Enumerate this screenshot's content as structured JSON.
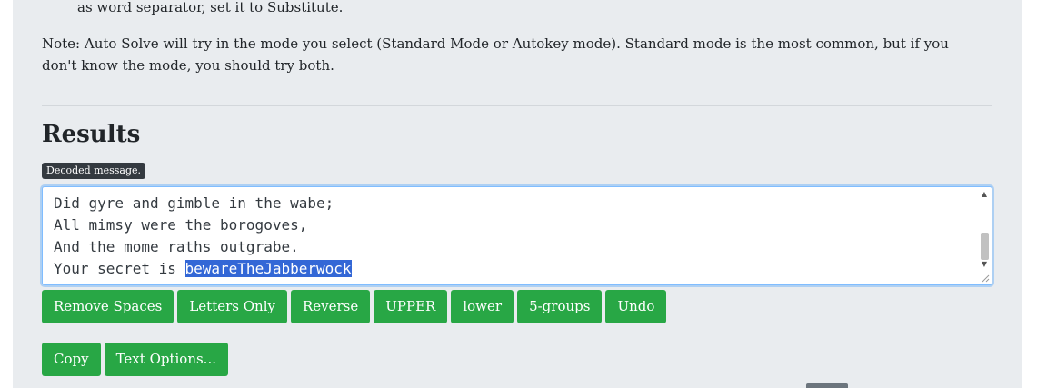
{
  "instructions": {
    "line_fragment": "as word separator, set it to Substitute.",
    "note": "Note: Auto Solve will try in the mode you select (Standard Mode or Autokey mode). Standard mode is the most common, but if you don't know the mode, you should try both."
  },
  "results": {
    "title": "Results",
    "tooltip": "Decoded message.",
    "output_lines": [
      "Did gyre and gimble in the wabe;",
      "All mimsy were the borogoves,",
      "And the mome raths outgrabe.",
      "Your secret is "
    ],
    "selected_text": "bewareTheJabberwock"
  },
  "buttons": {
    "remove_spaces": "Remove Spaces",
    "letters_only": "Letters Only",
    "reverse": "Reverse",
    "upper": "UPPER",
    "lower": "lower",
    "groups": "5-groups",
    "undo": "Undo",
    "copy": "Copy",
    "text_options": "Text Options..."
  },
  "colors": {
    "button": "#28a745",
    "panel": "#e9ecef",
    "selection": "#3367d6",
    "focus_border": "#80bdff"
  }
}
